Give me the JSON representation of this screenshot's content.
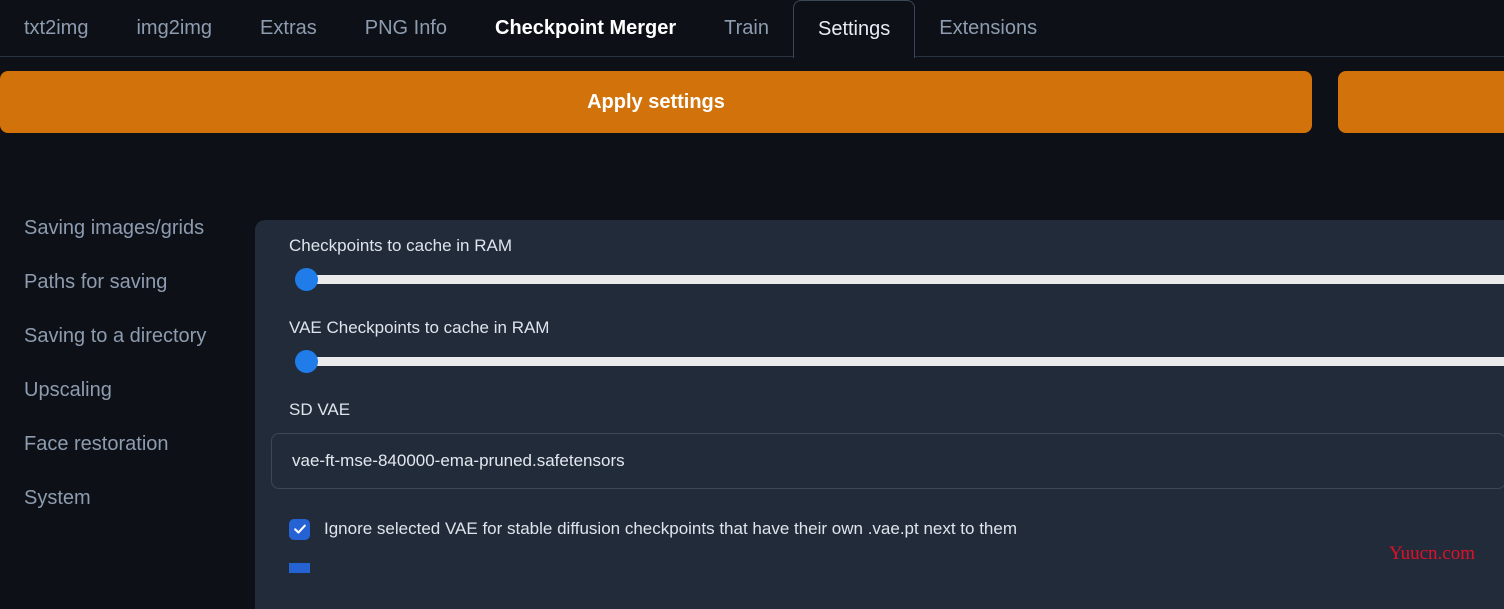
{
  "tabs": [
    {
      "label": "txt2img",
      "state": "normal"
    },
    {
      "label": "img2img",
      "state": "normal"
    },
    {
      "label": "Extras",
      "state": "normal"
    },
    {
      "label": "PNG Info",
      "state": "normal"
    },
    {
      "label": "Checkpoint Merger",
      "state": "hovered"
    },
    {
      "label": "Train",
      "state": "normal"
    },
    {
      "label": "Settings",
      "state": "active"
    },
    {
      "label": "Extensions",
      "state": "normal"
    }
  ],
  "toolbar": {
    "apply_label": "Apply settings",
    "secondary_label": "",
    "accent_color": "#d2720a"
  },
  "sidebar": {
    "items": [
      {
        "label": "Saving images/grids"
      },
      {
        "label": "Paths for saving"
      },
      {
        "label": "Saving to a directory"
      },
      {
        "label": "Upscaling"
      },
      {
        "label": "Face restoration"
      },
      {
        "label": "System"
      }
    ]
  },
  "settings": {
    "sliders": [
      {
        "label": "Checkpoints to cache in RAM",
        "value": 0
      },
      {
        "label": "VAE Checkpoints to cache in RAM",
        "value": 0
      }
    ],
    "dropdown": {
      "label": "SD VAE",
      "value": "vae-ft-mse-840000-ema-pruned.safetensors"
    },
    "checkboxes": [
      {
        "label": "Ignore selected VAE for stable diffusion checkpoints that have their own .vae.pt next to them",
        "checked": true
      },
      {
        "label": "",
        "checked": false
      }
    ]
  },
  "watermark": {
    "text": "Yuucn.com",
    "color": "#e0102a"
  }
}
